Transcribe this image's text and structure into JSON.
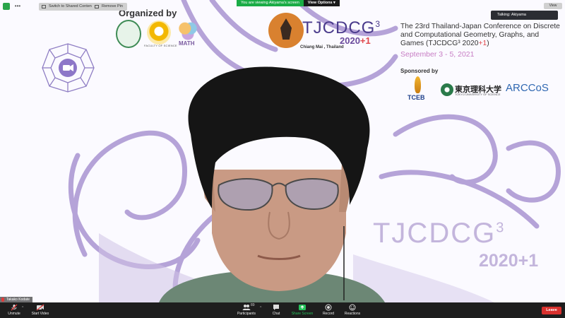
{
  "slide": {
    "organized_by": "Organized by",
    "faculty_caption": "FACULTY OF SCIENCE",
    "math_caption": "MATH",
    "conference_name": "TJCDCG",
    "conference_sup": "3",
    "conference_year": "2020",
    "conference_plus": "+1",
    "location": "Chiang Mai , Thailand",
    "title_main": "The 23rd Thailand-Japan Conference on Discrete and Computational Geometry, Graphs, and Games (TJCDCG³ 2020",
    "title_plus": "+1",
    "title_close": ")",
    "dates": "September 3 - 5, 2021",
    "sponsored_by": "Sponsored by",
    "sponsor_tceb": "TCEB",
    "sponsor_tus": "東京理科大学",
    "sponsor_tus_sub": "TOKYO UNIVERSITY OF SCIENCE",
    "sponsor_arccos": "ARCCoS",
    "big_mark": "TJCDCG",
    "big_mark_sup": "3",
    "big_year": "2020+1"
  },
  "overlay": {
    "switch_label": "Switch to Shared Content",
    "remove_pin_label": "Remove Pin",
    "sharing_message": "You are viewing Akiyama's screen",
    "view_options": "View Options ▾",
    "view_label": "View",
    "talking": "Talking: Akiyama"
  },
  "participant_name": "Takako Kodate",
  "toolbar": {
    "unmute": "Unmute",
    "start_video": "Start Video",
    "participants": "Participants",
    "participants_count": "89",
    "chat": "Chat",
    "share_screen": "Share Screen",
    "record": "Record",
    "reactions": "Reactions",
    "leave": "Leave"
  },
  "colors": {
    "accent_purple": "#b5a3d8",
    "share_green": "#1aac46",
    "leave_red": "#d8312e",
    "toolbar_bg": "#1e1e1e"
  },
  "icons": {
    "security": "shield-icon",
    "video_call": "video-camera-icon",
    "mic": "microphone-muted-icon",
    "camera": "camera-off-icon",
    "participants": "people-icon",
    "chat": "chat-bubble-icon",
    "share": "share-screen-icon",
    "record": "record-icon",
    "reactions": "smiley-icon"
  }
}
